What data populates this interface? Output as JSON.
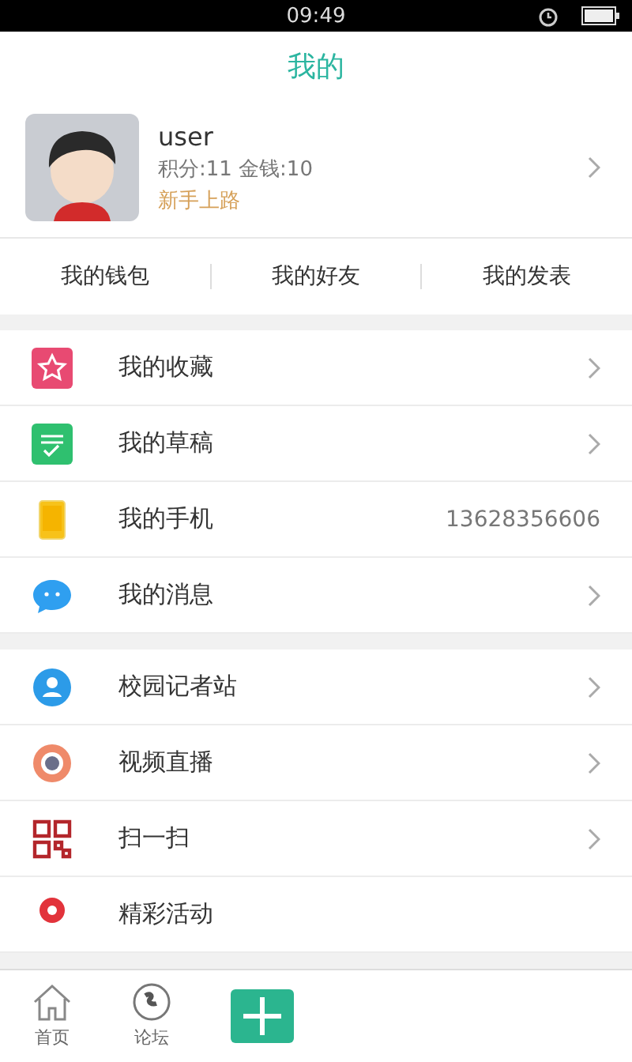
{
  "status_bar": {
    "time": "09:49"
  },
  "header": {
    "title": "我的"
  },
  "profile": {
    "name": "user",
    "stats": "积分:11   金钱:10",
    "rank": "新手上路"
  },
  "quick_tabs": [
    "我的钱包",
    "我的好友",
    "我的发表"
  ],
  "menu_groups": [
    [
      {
        "kind": "star",
        "label": "我的收藏",
        "arrow": true
      },
      {
        "kind": "draft",
        "label": "我的草稿",
        "arrow": true
      },
      {
        "kind": "phone",
        "label": "我的手机",
        "value": "13628356606",
        "arrow": false
      },
      {
        "kind": "message",
        "label": "我的消息",
        "arrow": true
      }
    ],
    [
      {
        "kind": "reporter",
        "label": "校园记者站",
        "arrow": true
      },
      {
        "kind": "video",
        "label": "视频直播",
        "arrow": true
      },
      {
        "kind": "scan",
        "label": "扫一扫",
        "arrow": true
      },
      {
        "kind": "event",
        "label": "精彩活动",
        "arrow": false
      }
    ]
  ],
  "bottom_nav": [
    {
      "kind": "home",
      "label": "首页"
    },
    {
      "kind": "forum",
      "label": "论坛"
    },
    {
      "kind": "add"
    }
  ]
}
